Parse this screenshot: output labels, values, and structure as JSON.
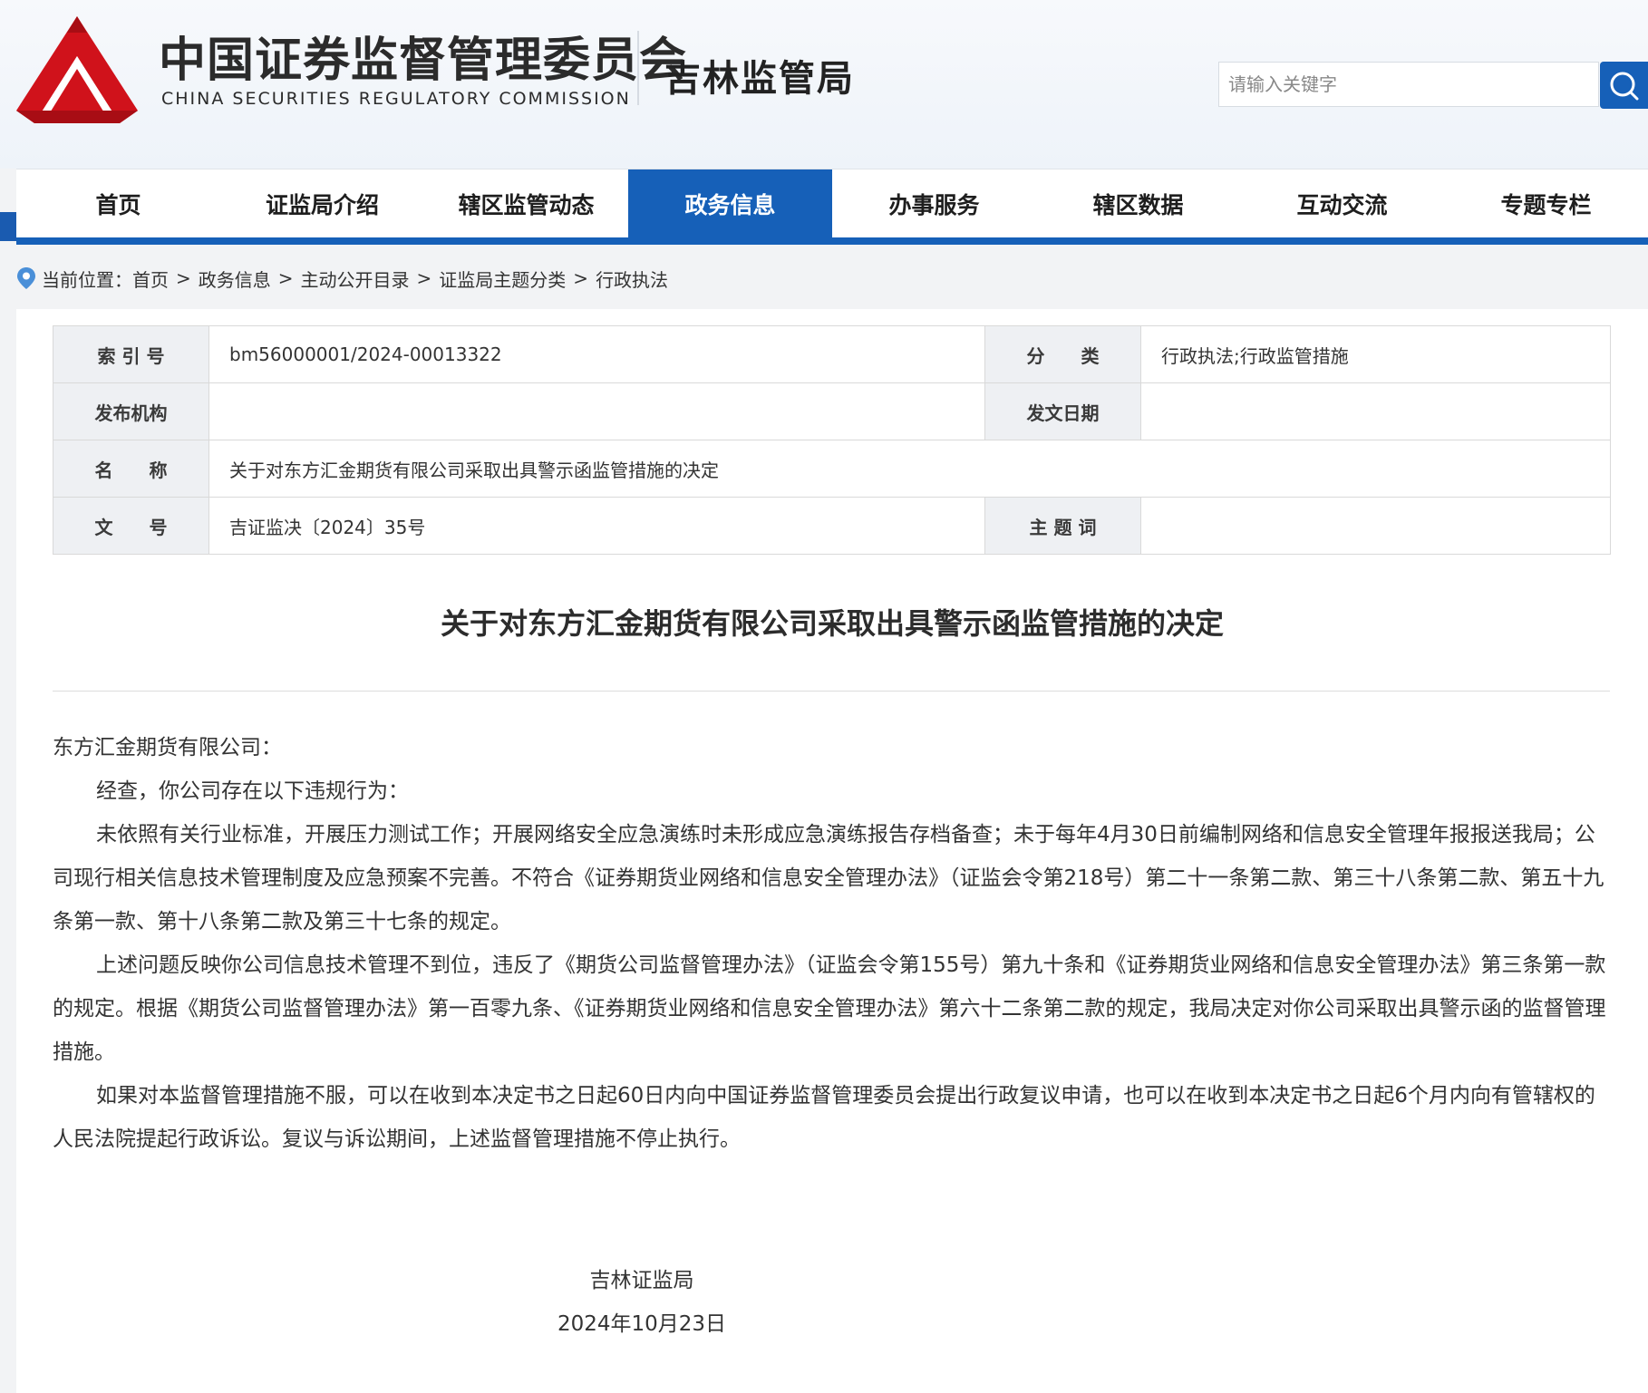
{
  "header": {
    "org_cn": "中国证券监督管理委员会",
    "org_en": "CHINA SECURITIES REGULATORY COMMISSION",
    "bureau": "吉林监管局",
    "search_placeholder": "请输入关键字",
    "search_icon": "search-icon",
    "brand_red": "#d0121b",
    "accent_blue": "#1660b8"
  },
  "nav": {
    "items": [
      {
        "label": "首页"
      },
      {
        "label": "证监局介绍"
      },
      {
        "label": "辖区监管动态"
      },
      {
        "label": "政务信息",
        "active": true
      },
      {
        "label": "办事服务"
      },
      {
        "label": "辖区数据"
      },
      {
        "label": "互动交流"
      },
      {
        "label": "专题专栏"
      }
    ]
  },
  "breadcrumb": {
    "prefix": "当前位置：",
    "sep": ">",
    "items": [
      "首页",
      "政务信息",
      "主动公开目录",
      "证监局主题分类",
      "行政执法"
    ]
  },
  "meta": {
    "index_label": "索 引 号",
    "index_value": "bm56000001/2024-00013322",
    "category_label": "分　　类",
    "category_value": "行政执法;行政监管措施",
    "publisher_label": "发布机构",
    "publisher_value": "",
    "date_label": "发文日期",
    "date_value": "",
    "name_label": "名　　称",
    "name_value": "关于对东方汇金期货有限公司采取出具警示函监管措施的决定",
    "docno_label": "文　　号",
    "docno_value": "吉证监决〔2024〕35号",
    "keyword_label": "主 题 词",
    "keyword_value": ""
  },
  "document": {
    "title": "关于对东方汇金期货有限公司采取出具警示函监管措施的决定",
    "salutation": "东方汇金期货有限公司：",
    "paragraphs": [
      "经查，你公司存在以下违规行为：",
      "未依照有关行业标准，开展压力测试工作；开展网络安全应急演练时未形成应急演练报告存档备查；未于每年4月30日前编制网络和信息安全管理年报报送我局；公司现行相关信息技术管理制度及应急预案不完善。不符合《证券期货业网络和信息安全管理办法》（证监会令第218号）第二十一条第二款、第三十八条第二款、第五十九条第一款、第十八条第二款及第三十七条的规定。",
      "上述问题反映你公司信息技术管理不到位，违反了《期货公司监督管理办法》（证监会令第155号）第九十条和《证券期货业网络和信息安全管理办法》第三条第一款的规定。根据《期货公司监督管理办法》第一百零九条、《证券期货业网络和信息安全管理办法》第六十二条第二款的规定，我局决定对你公司采取出具警示函的监督管理措施。",
      "如果对本监督管理措施不服，可以在收到本决定书之日起60日内向中国证券监督管理委员会提出行政复议申请，也可以在收到本决定书之日起6个月内向有管辖权的人民法院提起行政诉讼。复议与诉讼期间，上述监督管理措施不停止执行。"
    ],
    "signature": "吉林证监局",
    "sign_date": "2024年10月23日"
  }
}
